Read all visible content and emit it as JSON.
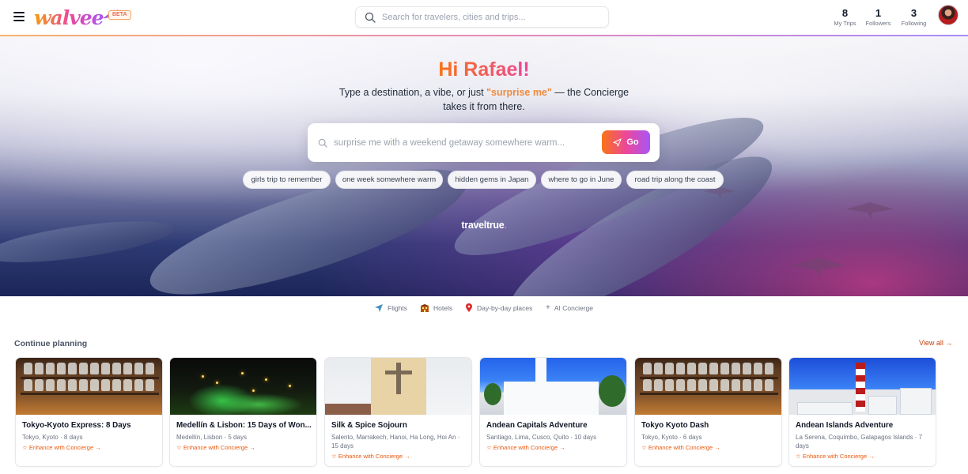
{
  "header": {
    "logo_text": "walvee",
    "beta_label": "BETA",
    "search_placeholder": "Search for travelers, cities and trips...",
    "stats": [
      {
        "value": "8",
        "label": "My Trips"
      },
      {
        "value": "1",
        "label": "Followers"
      },
      {
        "value": "3",
        "label": "Following"
      }
    ],
    "accent_colors": [
      "#f59e0b",
      "#ec4899",
      "#a855f7"
    ]
  },
  "hero": {
    "title": "Hi Rafael!",
    "subtitle_before": "Type a destination, a vibe, or just ",
    "subtitle_highlight": "\"surprise me\"",
    "subtitle_after": " — the Concierge",
    "subtitle_line2": "takes it from there.",
    "concierge_placeholder": "surprise me with a weekend getaway somewhere warm...",
    "go_label": "Go",
    "chips": [
      "girls trip to remember",
      "one week somewhere warm",
      "hidden gems in Japan",
      "where to go in June",
      "road trip along the coast"
    ],
    "brand_main": "traveltrue",
    "brand_dot": "."
  },
  "modes": [
    {
      "icon": "plane-icon",
      "label": "Flights"
    },
    {
      "icon": "hotel-icon",
      "label": "Hotels"
    },
    {
      "icon": "map-pin-icon",
      "label": "Day-by-day places"
    },
    {
      "icon": "plus-icon",
      "label": "AI Concierge"
    }
  ],
  "continue_planning": {
    "title": "Continue planning",
    "view_all": "View all →",
    "cards": [
      {
        "title": "Tokyo-Kyoto Express: 8 Days",
        "subtitle": "Tokyo, Kyoto · 8 days",
        "action": "Enhance with Concierge →",
        "thumb": "jars"
      },
      {
        "title": "Medellín & Lisbon: 15 Days of Won...",
        "subtitle": "Medellín, Lisbon · 5 days",
        "action": "Enhance with Concierge →",
        "thumb": "night"
      },
      {
        "title": "Silk & Spice Sojourn",
        "subtitle": "Salento, Marrakech, Hanoi, Ha Long, Hoi An · 15 days",
        "action": "Enhance with Concierge →",
        "thumb": "church"
      },
      {
        "title": "Andean Capitals Adventure",
        "subtitle": "Santiago, Lima, Cusco, Quito · 10 days",
        "action": "Enhance with Concierge →",
        "thumb": "white"
      },
      {
        "title": "Tokyo Kyoto Dash",
        "subtitle": "Tokyo, Kyoto · 6 days",
        "action": "Enhance with Concierge →",
        "thumb": "jars"
      },
      {
        "title": "Andean Islands Adventure",
        "subtitle": "La Serena, Coquimbo, Galapagos Islands · 7 days",
        "action": "Enhance with Concierge →",
        "thumb": "light"
      }
    ]
  }
}
